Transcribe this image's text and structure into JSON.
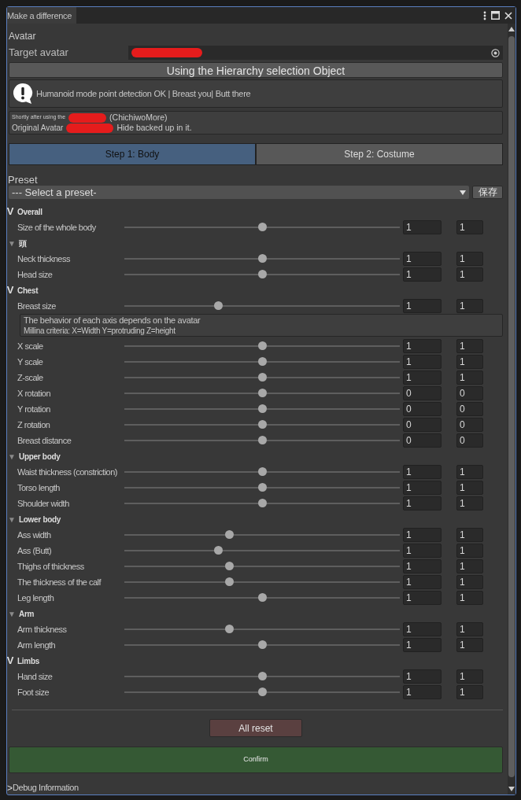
{
  "window": {
    "title": "Make a difference"
  },
  "avatar": {
    "heading": "Avatar",
    "target_label": "Target avatar",
    "hierarchy_button": "Using the Hierarchy selection Object",
    "message": "Humanoid mode point detection OK | Breast you| Butt there",
    "info": [
      {
        "before": "Shortly after using the",
        "after": "(ChichiwoMore)"
      },
      {
        "before": "Original Avatar",
        "after": "Hide backed up in it."
      }
    ]
  },
  "steps": [
    {
      "label": "Step 1: Body",
      "selected": true
    },
    {
      "label": "Step 2: Costume",
      "selected": false
    }
  ],
  "preset": {
    "heading": "Preset",
    "dropdown": "--- Select a preset-",
    "save_button": "保存"
  },
  "sections": [
    {
      "toggle": "V",
      "title": "Overall",
      "rows": [
        {
          "kind": "slider",
          "label": "Size of the whole body",
          "level": 0.5,
          "value": "1",
          "value_2": "1"
        }
      ]
    },
    {
      "toggle": "▼",
      "title": "頭",
      "rows": [
        {
          "kind": "slider",
          "label": "Neck thickness",
          "level": 0.5,
          "value": "1",
          "value_2": "1"
        },
        {
          "kind": "slider",
          "label": "Head size",
          "level": 0.5,
          "value": "1",
          "value_2": "1"
        }
      ]
    },
    {
      "toggle": "V",
      "title": "Chest",
      "rows": [
        {
          "kind": "slider",
          "label": "Breast size",
          "level": 0.34,
          "value": "1",
          "value_2": "1"
        },
        {
          "kind": "note",
          "lines": [
            "The behavior of each axis depends on the avatar",
            "Millina criteria: X=Width Y=protruding Z=height"
          ]
        },
        {
          "kind": "slider",
          "label": "X scale",
          "level": 0.5,
          "value": "1",
          "value_2": "1"
        },
        {
          "kind": "slider",
          "label": "Y scale",
          "level": 0.5,
          "value": "1",
          "value_2": "1"
        },
        {
          "kind": "slider",
          "label": "Z-scale",
          "level": 0.5,
          "value": "1",
          "value_2": "1"
        },
        {
          "kind": "slider",
          "label": "X rotation",
          "level": 0.5,
          "value": "0",
          "value_2": "0"
        },
        {
          "kind": "slider",
          "label": "Y rotation",
          "level": 0.5,
          "value": "0",
          "value_2": "0"
        },
        {
          "kind": "slider",
          "label": "Z rotation",
          "level": 0.5,
          "value": "0",
          "value_2": "0"
        },
        {
          "kind": "slider",
          "label": "Breast distance",
          "level": 0.5,
          "value": "0",
          "value_2": "0"
        }
      ]
    },
    {
      "toggle": "▼",
      "title": "Upper body",
      "rows": [
        {
          "kind": "slider",
          "label": "Waist thickness (constriction)",
          "level": 0.5,
          "value": "1",
          "value_2": "1"
        },
        {
          "kind": "slider",
          "label": "Torso length",
          "level": 0.5,
          "value": "1",
          "value_2": "1"
        },
        {
          "kind": "slider",
          "label": "Shoulder width",
          "level": 0.5,
          "value": "1",
          "value_2": "1"
        }
      ]
    },
    {
      "toggle": "▼",
      "title": "Lower body",
      "rows": [
        {
          "kind": "slider",
          "label": "Ass width",
          "level": 0.38,
          "value": "1",
          "value_2": "1"
        },
        {
          "kind": "slider",
          "label": "Ass (Butt)",
          "level": 0.34,
          "value": "1",
          "value_2": "1"
        },
        {
          "kind": "slider",
          "label": "Thighs of thickness",
          "level": 0.38,
          "value": "1",
          "value_2": "1"
        },
        {
          "kind": "slider",
          "label": "The thickness of the calf",
          "level": 0.38,
          "value": "1",
          "value_2": "1"
        },
        {
          "kind": "slider",
          "label": "Leg length",
          "level": 0.5,
          "value": "1",
          "value_2": "1"
        }
      ]
    },
    {
      "toggle": "▼",
      "title": "Arm",
      "rows": [
        {
          "kind": "slider",
          "label": "Arm thickness",
          "level": 0.38,
          "value": "1",
          "value_2": "1"
        },
        {
          "kind": "slider",
          "label": "Arm length",
          "level": 0.5,
          "value": "1",
          "value_2": "1"
        }
      ]
    },
    {
      "toggle": "V",
      "title": "Limbs",
      "rows": [
        {
          "kind": "slider",
          "label": "Hand size",
          "level": 0.5,
          "value": "1",
          "value_2": "1"
        },
        {
          "kind": "slider",
          "label": "Foot size",
          "level": 0.5,
          "value": "1",
          "value_2": "1"
        }
      ]
    }
  ],
  "reset_button": "All reset",
  "confirm_button": "Confirm",
  "debug": {
    "toggle": ">",
    "label": "Debug Information"
  }
}
